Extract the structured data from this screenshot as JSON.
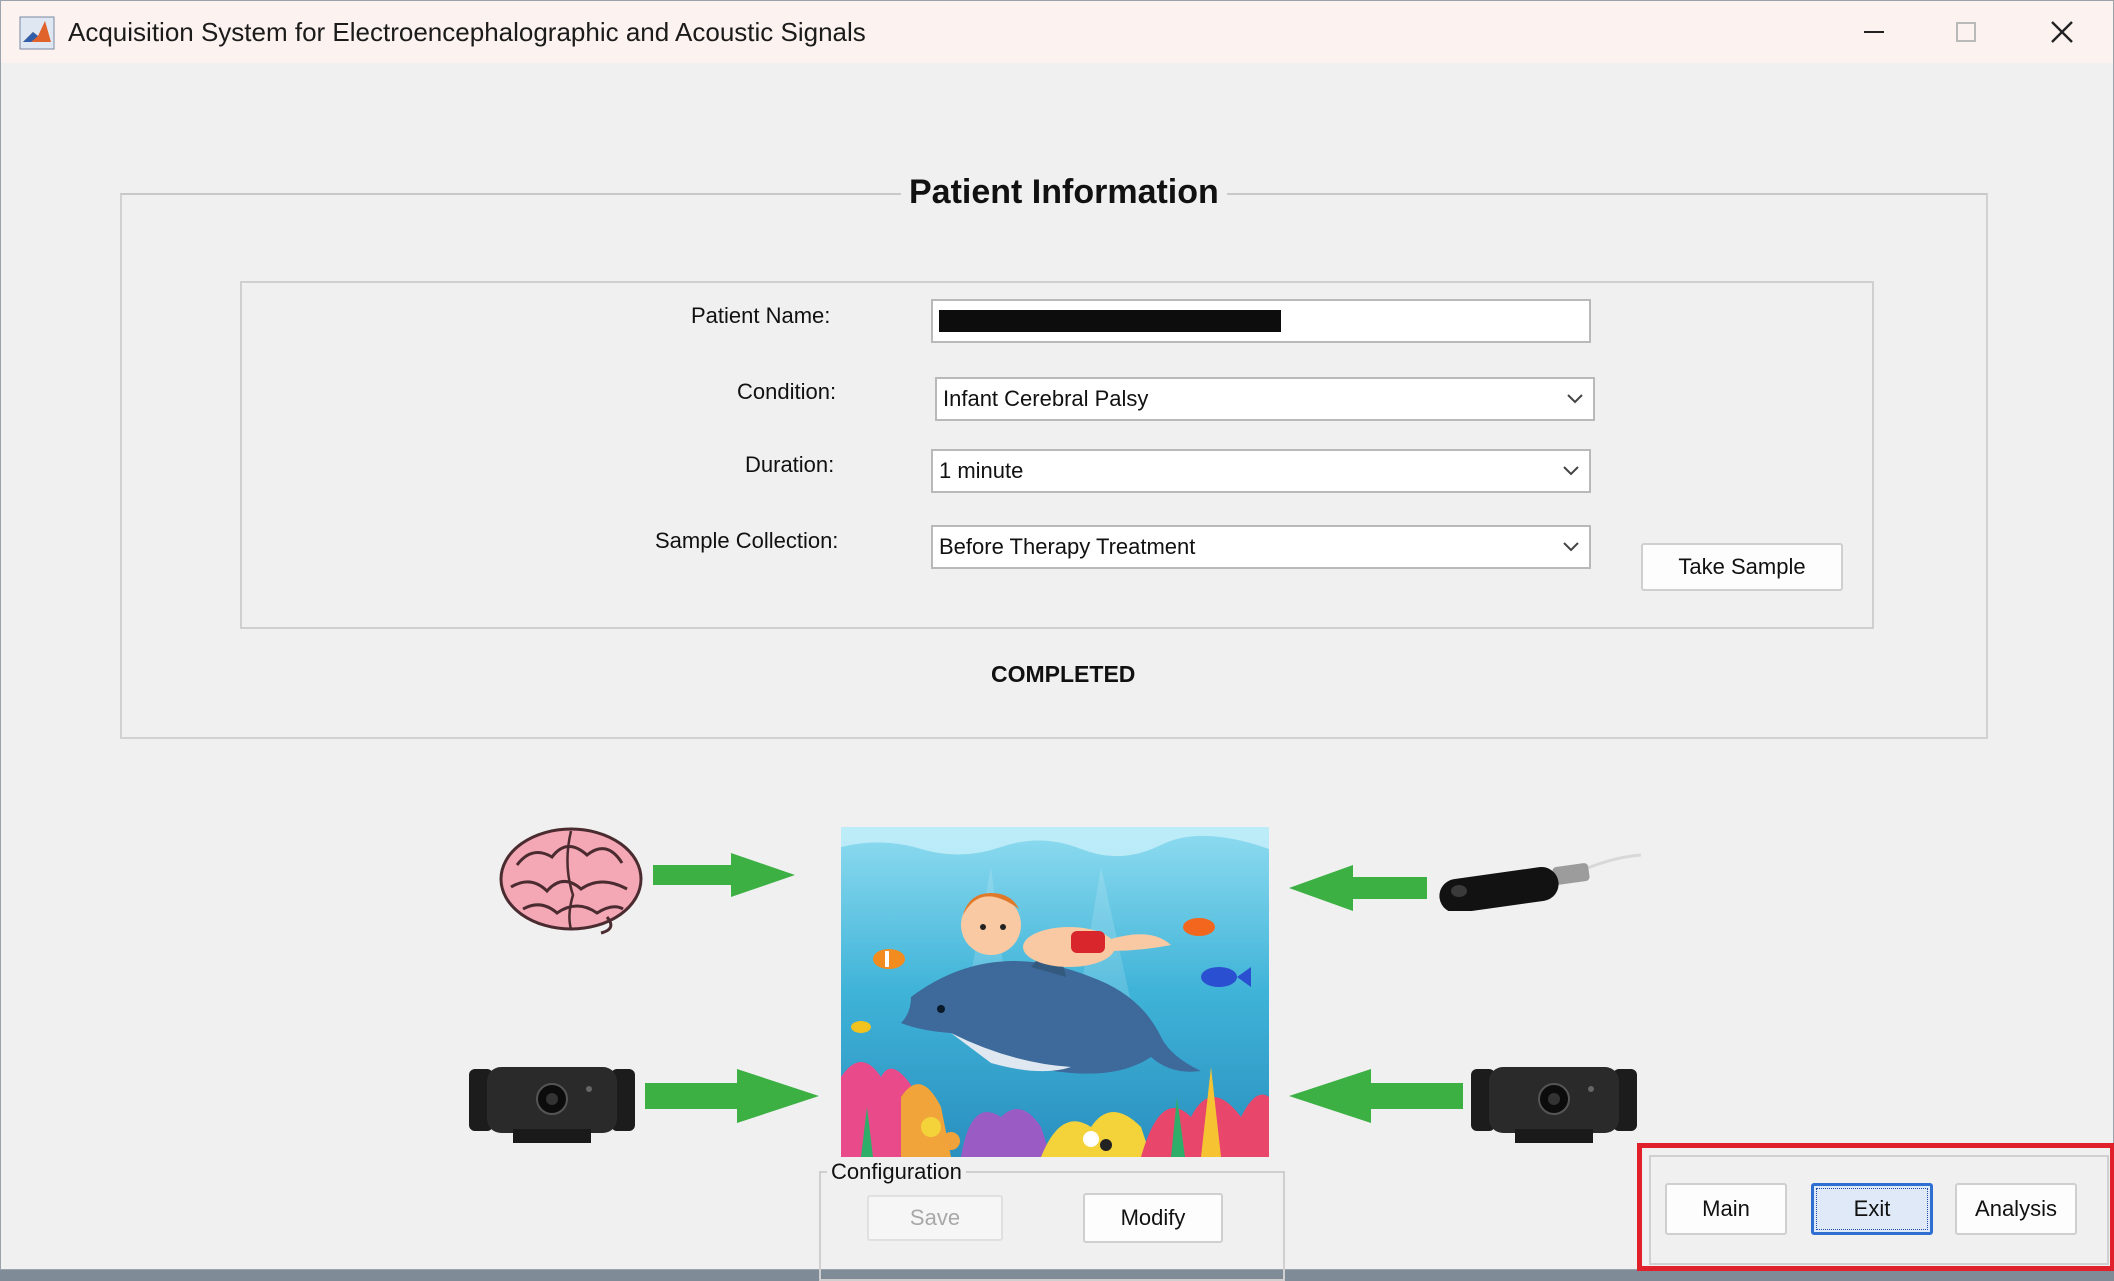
{
  "window": {
    "title": "Acquisition System for Electroencephalographic and Acoustic Signals",
    "controls": [
      "minimize-icon",
      "maximize-icon",
      "close-icon"
    ]
  },
  "patient_panel": {
    "title": "Patient Information",
    "name_label": "Patient Name:",
    "name_value": "",
    "condition_label": "Condition:",
    "condition_value": "Infant Cerebral Palsy",
    "duration_label": "Duration:",
    "duration_value": "1 minute",
    "collection_label": "Sample Collection:",
    "collection_value": "Before Therapy Treatment",
    "take_sample_label": "Take Sample",
    "status_text": "COMPLETED"
  },
  "illustration": {
    "items": [
      "brain-image",
      "hydrophone-image",
      "webcam-left-image",
      "webcam-right-image",
      "underwater-scene-image",
      "arrow-icons"
    ],
    "arrow_color": "#3cb043"
  },
  "configuration": {
    "title": "Configuration",
    "save_label": "Save",
    "modify_label": "Modify"
  },
  "navigation": {
    "main_label": "Main",
    "exit_label": "Exit",
    "analysis_label": "Analysis",
    "highlight_color": "#e0202a"
  }
}
